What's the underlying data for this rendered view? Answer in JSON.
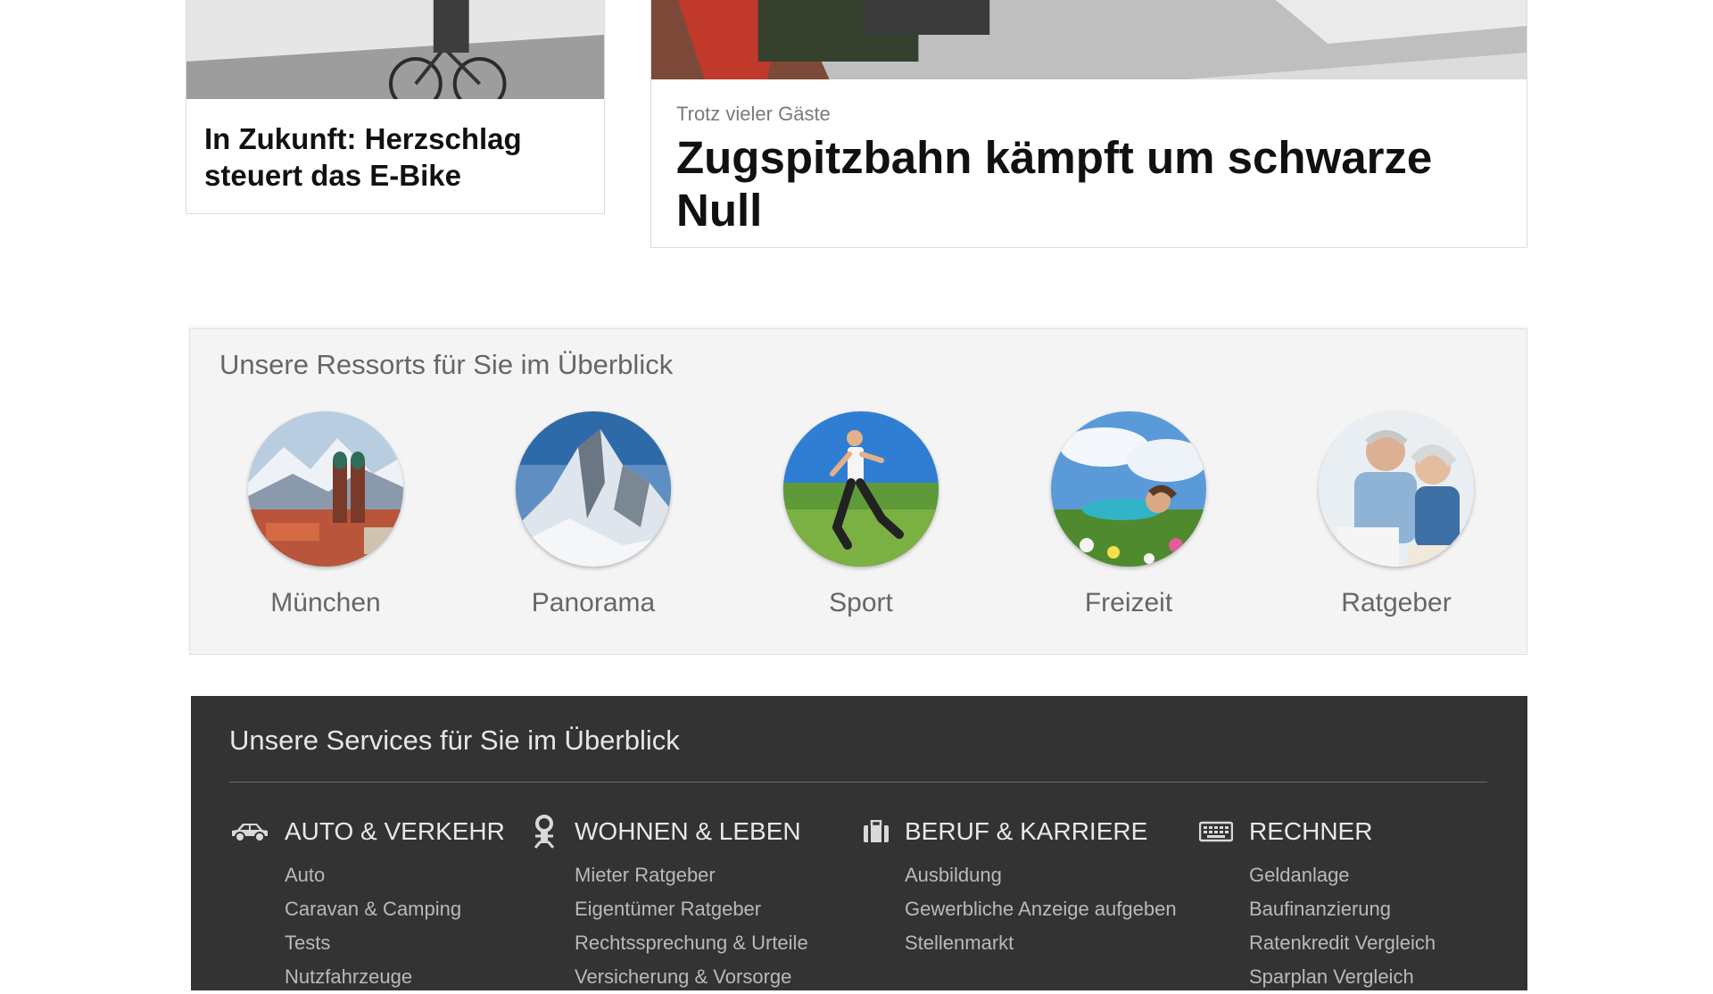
{
  "articles": [
    {
      "kicker": "",
      "headline": "In Zukunft: Herzschlag steuert das E-Bike"
    },
    {
      "kicker": "Trotz vieler Gäste",
      "headline": "Zugspitzbahn kämpft um schwarze Null"
    }
  ],
  "ressorts": {
    "title": "Unsere Ressorts für Sie im Überblick",
    "items": [
      {
        "label": "München"
      },
      {
        "label": "Panorama"
      },
      {
        "label": "Sport"
      },
      {
        "label": "Freizeit"
      },
      {
        "label": "Ratgeber"
      }
    ]
  },
  "services": {
    "title": "Unsere Services für Sie im Überblick",
    "columns": [
      {
        "icon": "car-icon",
        "heading": "AUTO & VERKEHR",
        "links": [
          "Auto",
          "Caravan & Camping",
          "Tests",
          "Nutzfahrzeuge"
        ]
      },
      {
        "icon": "key-icon",
        "heading": "WOHNEN & LEBEN",
        "links": [
          "Mieter Ratgeber",
          "Eigentümer Ratgeber",
          "Rechtssprechung & Urteile",
          "Versicherung & Vorsorge"
        ]
      },
      {
        "icon": "briefcase-icon",
        "heading": "BERUF & KARRIERE",
        "links": [
          "Ausbildung",
          "Gewerbliche Anzeige aufgeben",
          "Stellenmarkt"
        ]
      },
      {
        "icon": "keyboard-icon",
        "heading": "RECHNER",
        "links": [
          "Geldanlage",
          "Baufinanzierung",
          "Ratenkredit Vergleich",
          "Sparplan Vergleich"
        ]
      }
    ]
  }
}
